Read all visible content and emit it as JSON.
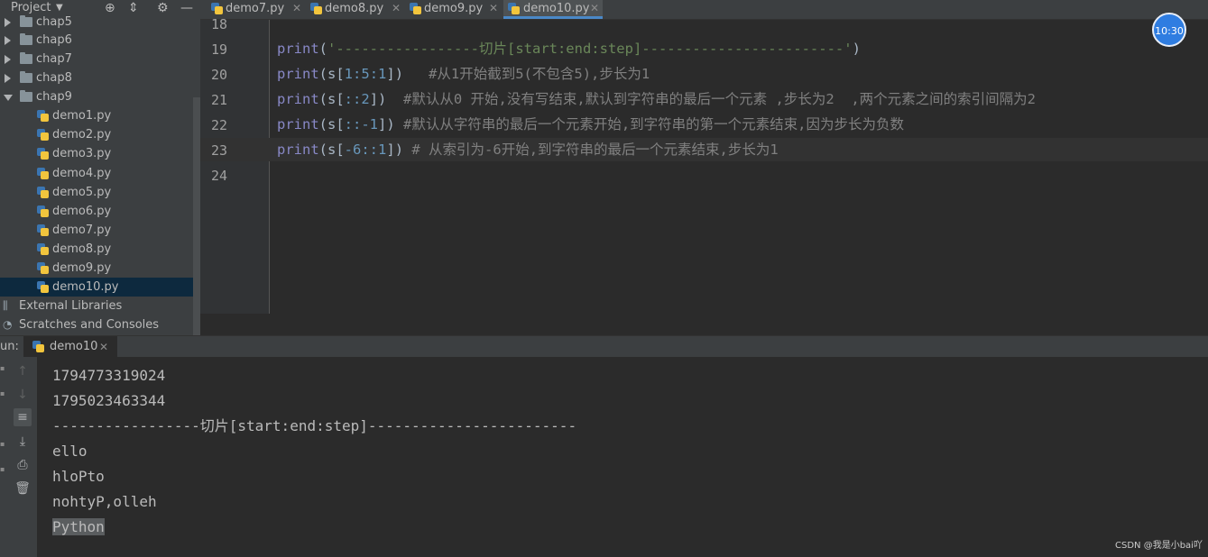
{
  "project_panel": {
    "title": "Project",
    "tree": [
      {
        "label": "chap5",
        "type": "folder",
        "state": "collapsed"
      },
      {
        "label": "chap6",
        "type": "folder",
        "state": "collapsed"
      },
      {
        "label": "chap7",
        "type": "folder",
        "state": "collapsed"
      },
      {
        "label": "chap8",
        "type": "folder",
        "state": "collapsed"
      },
      {
        "label": "chap9",
        "type": "folder",
        "state": "expanded"
      },
      {
        "label": "demo1.py",
        "type": "file"
      },
      {
        "label": "demo2.py",
        "type": "file"
      },
      {
        "label": "demo3.py",
        "type": "file"
      },
      {
        "label": "demo4.py",
        "type": "file"
      },
      {
        "label": "demo5.py",
        "type": "file"
      },
      {
        "label": "demo6.py",
        "type": "file"
      },
      {
        "label": "demo7.py",
        "type": "file"
      },
      {
        "label": "demo8.py",
        "type": "file"
      },
      {
        "label": "demo9.py",
        "type": "file"
      },
      {
        "label": "demo10.py",
        "type": "file",
        "selected": true
      },
      {
        "label": "External Libraries",
        "type": "library"
      },
      {
        "label": "Scratches and Consoles",
        "type": "scratches"
      }
    ]
  },
  "editor_tabs": [
    {
      "label": "demo7.py",
      "active": false
    },
    {
      "label": "demo8.py",
      "active": false
    },
    {
      "label": "demo9.py",
      "active": false
    },
    {
      "label": "demo10.py",
      "active": true
    }
  ],
  "editor": {
    "line_numbers": [
      "18",
      "19",
      "20",
      "21",
      "22",
      "23",
      "24"
    ],
    "current_line": "23",
    "code": {
      "l19": {
        "fn": "print",
        "open": "(",
        "str": "'-----------------切片[start:end:step]------------------------'",
        "close": ")"
      },
      "l20": {
        "fn": "print",
        "pre": "(s[",
        "a": "1",
        "c1": ":",
        "b": "5",
        "c2": ":",
        "c": "1",
        "post": "])",
        "comment": "   #从1开始截到5(不包含5),步长为1"
      },
      "l21": {
        "fn": "print",
        "pre": "(s[",
        "c1": "::",
        "b": "2",
        "post": "])",
        "comment": "  #默认从0 开始,没有写结束,默认到字符串的最后一个元素 ,步长为2  ,两个元素之间的索引间隔为2"
      },
      "l22": {
        "fn": "print",
        "pre": "(s[",
        "c1": "::",
        "b": "-1",
        "post": "])",
        "comment": " #默认从字符串的最后一个元素开始,到字符串的第一个元素结束,因为步长为负数"
      },
      "l23": {
        "fn": "print",
        "pre": "(s[",
        "a": "-6",
        "c1": "::",
        "b": "1",
        "post": "])",
        "comment": " # 从索引为-6开始,到字符串的最后一个元素结束,步长为1"
      }
    }
  },
  "clock_badge": "10:30",
  "run_panel": {
    "label": "un:",
    "tab": "demo10",
    "output": [
      "1794773319024",
      "1795023463344",
      "-----------------切片[start:end:step]------------------------",
      "ello",
      "hloPto",
      "nohtyP,olleh",
      "Python"
    ],
    "toolbar_icons": [
      "arrow-up-icon",
      "arrow-down-icon",
      "soft-wrap-icon",
      "scroll-to-end-icon",
      "print-icon",
      "trash-icon"
    ]
  },
  "watermark": "CSDN @我是小bai吖",
  "colors": {
    "background": "#2b2b2b",
    "panel": "#3c3f41",
    "keyword": "#8888c6",
    "string": "#6a8759",
    "number": "#6897bb",
    "comment": "#808080",
    "selection": "#0d293e",
    "active_tab_underline": "#4a88c7"
  }
}
